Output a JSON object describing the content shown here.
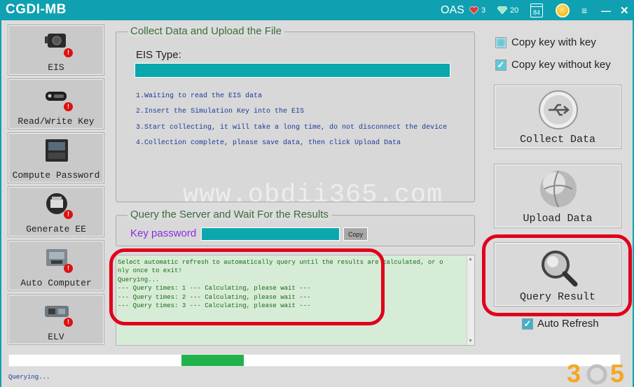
{
  "app": {
    "title": "CGDI-MB",
    "account": "OAS",
    "hearts": "3",
    "gems": "20",
    "calendar_day": "84",
    "menu_icon": "≡",
    "minimize_icon": "—",
    "close_icon": "✕"
  },
  "sidebar": {
    "items": [
      {
        "label": "EIS",
        "icon": "eis-module-icon"
      },
      {
        "label": "Read/Write Key",
        "icon": "car-key-icon"
      },
      {
        "label": "Compute Password",
        "icon": "keypad-device-icon"
      },
      {
        "label": "Generate EE",
        "icon": "printer-chip-icon"
      },
      {
        "label": "Auto Computer",
        "icon": "ecu-module-icon"
      },
      {
        "label": "ELV",
        "icon": "steering-lock-icon"
      }
    ],
    "warning_mark": "!"
  },
  "collect": {
    "title": "Collect Data and Upload the File",
    "eis_type_label": "EIS Type:",
    "eis_type_value": "",
    "steps": [
      "1.Waiting to read the EIS data",
      "2.Insert the Simulation Key into the EIS",
      "3.Start collecting, it will take a long time, do not disconnect the device",
      "4.Collection complete, please save data, then click Upload Data"
    ]
  },
  "watermark": "www.obdii365.com",
  "query": {
    "title": "Query the Server and Wait For the Results",
    "key_password_label": "Key password",
    "key_password_value": "",
    "copy_button": "Copy"
  },
  "log": {
    "lines": [
      "Select automatic refresh to automatically query until the results are calculated, or o",
      "nly once to exit!",
      "Querying...",
      "--- Query times: 1 --- Calculating, please wait ---",
      "--- Query times: 2 --- Calculating, please wait ---",
      "--- Query times: 3 --- Calculating, please wait ---"
    ]
  },
  "options": {
    "copy_with_key": {
      "label": "Copy key with key",
      "checked": false
    },
    "copy_without_key": {
      "label": "Copy key without key",
      "checked": true
    }
  },
  "actions": {
    "collect_data": "Collect Data",
    "upload_data": "Upload  Data",
    "query_result": "Query Result"
  },
  "auto_refresh": {
    "label": "Auto Refresh",
    "checked": true
  },
  "progress": {
    "start_fraction": 0.282,
    "end_fraction": 0.384
  },
  "status": "Querying...",
  "colors": {
    "accent": "#0fa1b1",
    "field": "#0aa7ad",
    "highlight": "#e0001a",
    "progress": "#22b24c"
  },
  "logo": {
    "text": "365"
  }
}
